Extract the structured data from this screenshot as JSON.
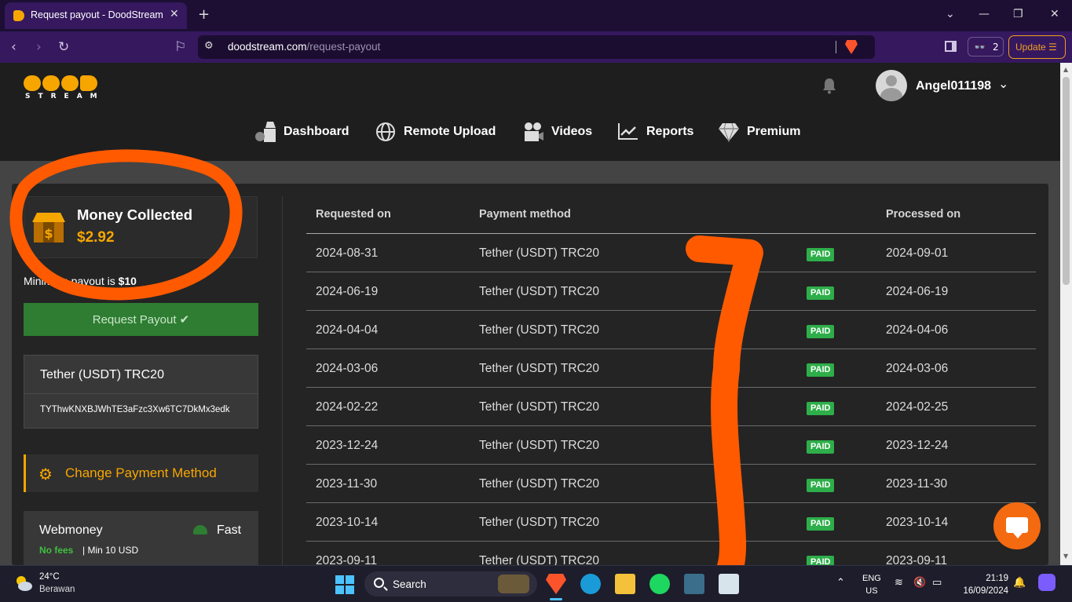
{
  "browser": {
    "tab_title": "Request payout - DoodStream",
    "url_host": "doodstream.com",
    "url_path": "/request-payout",
    "glasses_count": "2",
    "update_label": "Update"
  },
  "site": {
    "logo_text": "STREAM",
    "username": "Angel011198",
    "nav": [
      {
        "label": "Dashboard",
        "icon": "dashboard-icon"
      },
      {
        "label": "Remote Upload",
        "icon": "globe-icon"
      },
      {
        "label": "Videos",
        "icon": "camera-icon"
      },
      {
        "label": "Reports",
        "icon": "chart-icon"
      },
      {
        "label": "Premium",
        "icon": "diamond-icon"
      }
    ]
  },
  "payout": {
    "money_title": "Money Collected",
    "money_amount": "$2.92",
    "min_payout_prefix": "Minimum payout is",
    "min_payout_value": "$10",
    "request_button": "Request Payout",
    "wallet_method": "Tether (USDT) TRC20",
    "wallet_address": "TYThwKNXBJWhTE3aFzc3Xw6TC7DkMx3edk",
    "change_method_label": "Change Payment Method",
    "webmoney": {
      "title": "Webmoney",
      "speed": "Fast",
      "fees": "No fees",
      "min": "| Min 10 USD"
    }
  },
  "table": {
    "headers": {
      "requested": "Requested on",
      "method": "Payment method",
      "processed": "Processed on"
    },
    "rows": [
      {
        "requested": "2024-08-31",
        "method": "Tether (USDT) TRC20",
        "status": "PAID",
        "processed": "2024-09-01"
      },
      {
        "requested": "2024-06-19",
        "method": "Tether (USDT) TRC20",
        "status": "PAID",
        "processed": "2024-06-19"
      },
      {
        "requested": "2024-04-04",
        "method": "Tether (USDT) TRC20",
        "status": "PAID",
        "processed": "2024-04-06"
      },
      {
        "requested": "2024-03-06",
        "method": "Tether (USDT) TRC20",
        "status": "PAID",
        "processed": "2024-03-06"
      },
      {
        "requested": "2024-02-22",
        "method": "Tether (USDT) TRC20",
        "status": "PAID",
        "processed": "2024-02-25"
      },
      {
        "requested": "2023-12-24",
        "method": "Tether (USDT) TRC20",
        "status": "PAID",
        "processed": "2023-12-24"
      },
      {
        "requested": "2023-11-30",
        "method": "Tether (USDT) TRC20",
        "status": "PAID",
        "processed": "2023-11-30"
      },
      {
        "requested": "2023-10-14",
        "method": "Tether (USDT) TRC20",
        "status": "PAID",
        "processed": "2023-10-14"
      },
      {
        "requested": "2023-09-11",
        "method": "Tether (USDT) TRC20",
        "status": "PAID",
        "processed": "2023-09-11"
      }
    ]
  },
  "taskbar": {
    "temperature": "24°C",
    "condition": "Berawan",
    "search_label": "Search",
    "lang_line1": "ENG",
    "lang_line2": "US",
    "time": "21:19",
    "date": "16/09/2024"
  },
  "colors": {
    "brand": "#f7a600",
    "paid": "#2eae4a",
    "annotation": "#ff5a00"
  }
}
